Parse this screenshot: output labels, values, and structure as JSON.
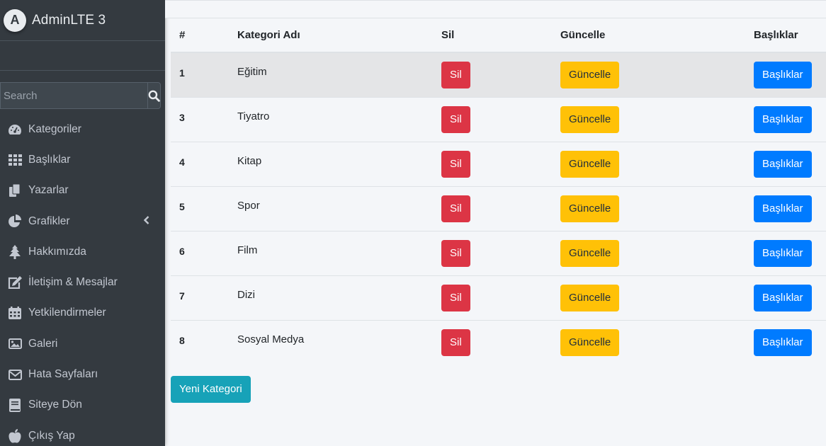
{
  "brand": {
    "name": "AdminLTE 3",
    "logo_letter": "A"
  },
  "search": {
    "placeholder": "Search"
  },
  "sidebar": {
    "items": [
      {
        "label": "Kategoriler",
        "icon": "dashboard-gauge-icon"
      },
      {
        "label": "Başlıklar",
        "icon": "grid-icon"
      },
      {
        "label": "Yazarlar",
        "icon": "copy-icon"
      },
      {
        "label": "Grafikler",
        "icon": "pie-chart-icon",
        "has_arrow": true
      },
      {
        "label": "Hakkımızda",
        "icon": "tree-icon"
      },
      {
        "label": "İletişim & Mesajlar",
        "icon": "edit-icon"
      },
      {
        "label": "Yetkilendirmeler",
        "icon": "calendar-icon"
      },
      {
        "label": "Galeri",
        "icon": "image-icon"
      },
      {
        "label": "Hata Sayfaları",
        "icon": "envelope-icon"
      },
      {
        "label": "Siteye Dön",
        "icon": "book-icon"
      },
      {
        "label": "Çıkış Yap",
        "icon": "apple-icon"
      }
    ]
  },
  "table": {
    "headers": {
      "id": "#",
      "name": "Kategori Adı",
      "delete": "Sil",
      "update": "Güncelle",
      "titles": "Başlıklar"
    },
    "rows": [
      {
        "id": "1",
        "name": "Eğitim"
      },
      {
        "id": "3",
        "name": "Tiyatro"
      },
      {
        "id": "4",
        "name": "Kitap"
      },
      {
        "id": "5",
        "name": "Spor"
      },
      {
        "id": "6",
        "name": "Film"
      },
      {
        "id": "7",
        "name": "Dizi"
      },
      {
        "id": "8",
        "name": "Sosyal Medya"
      }
    ],
    "delete_label": "Sil",
    "update_label": "Güncelle",
    "titles_label": "Başlıklar"
  },
  "new_category_label": "Yeni Kategori",
  "colors": {
    "danger": "#dc3545",
    "warning": "#ffc107",
    "primary": "#007bff",
    "info": "#17a2b8",
    "sidebar_bg": "#343a40"
  }
}
